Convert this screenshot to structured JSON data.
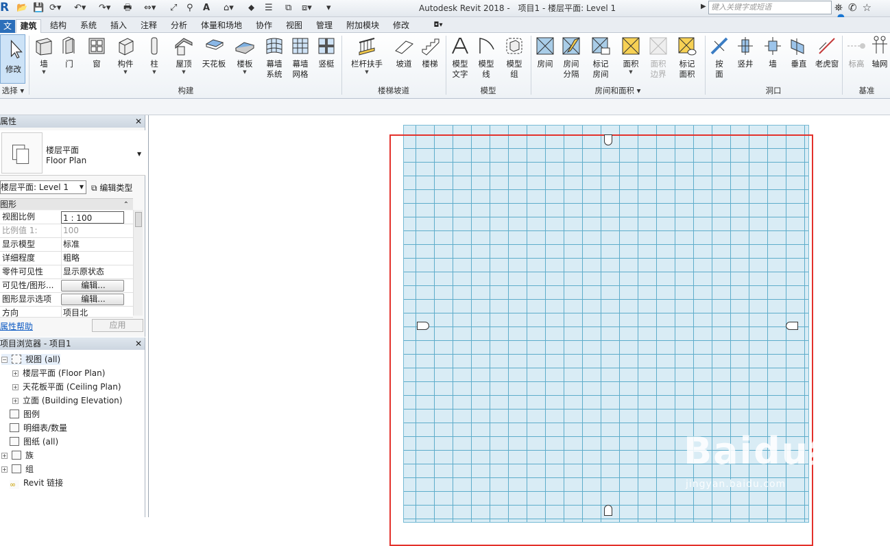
{
  "window": {
    "app_title": "Autodesk Revit 2018 -",
    "doc_title": "项目1 - 楼层平面: Level 1",
    "search_placeholder": "键入关键字或短语"
  },
  "tabs": [
    "文件",
    "建筑",
    "结构",
    "系统",
    "插入",
    "注释",
    "分析",
    "体量和场地",
    "协作",
    "视图",
    "管理",
    "附加模块",
    "修改"
  ],
  "active_tab": "建筑",
  "ribbon": {
    "modify": "修改",
    "select": "选择",
    "build": {
      "label": "构建",
      "buttons": [
        "墙",
        "门",
        "窗",
        "构件",
        "柱",
        "屋顶",
        "天花板",
        "楼板",
        "幕墙系统",
        "幕墙网格",
        "竖梃"
      ]
    },
    "circulation": {
      "label": "楼梯坡道",
      "buttons": [
        "栏杆扶手",
        "坡道",
        "楼梯"
      ]
    },
    "model": {
      "label": "模型",
      "buttons": [
        "模型文字",
        "模型线",
        "模型组"
      ]
    },
    "room_area": {
      "label": "房间和面积",
      "buttons": [
        "房间",
        "房间分隔",
        "标记房间",
        "面积",
        "面积边界",
        "标记面积"
      ]
    },
    "opening": {
      "label": "洞口",
      "buttons": [
        "按面",
        "竖井",
        "墙",
        "垂直",
        "老虎窗"
      ]
    },
    "datum": {
      "label": "基准",
      "buttons": [
        "标高",
        "轴网"
      ]
    }
  },
  "properties": {
    "title": "属性",
    "type_name_cn": "楼层平面",
    "type_name_en": "Floor Plan",
    "instance_selector": "楼层平面: Level 1",
    "edit_type": "编辑类型",
    "group": "图形",
    "rows": [
      {
        "key": "视图比例",
        "value": "1 : 100"
      },
      {
        "key": "比例值 1:",
        "value": "100"
      },
      {
        "key": "显示模型",
        "value": "标准"
      },
      {
        "key": "详细程度",
        "value": "粗略"
      },
      {
        "key": "零件可见性",
        "value": "显示原状态"
      },
      {
        "key": "可见性/图形...",
        "value": "编辑..."
      },
      {
        "key": "图形显示选项",
        "value": "编辑..."
      },
      {
        "key": "方向",
        "value": "项目北"
      }
    ],
    "help": "属性帮助",
    "apply": "应用"
  },
  "browser": {
    "title": "项目浏览器 - 项目1",
    "items": [
      "视图 (all)",
      "楼层平面 (Floor Plan)",
      "天花板平面 (Ceiling Plan)",
      "立面 (Building Elevation)",
      "图例",
      "明细表/数量",
      "图纸 (all)",
      "族",
      "组",
      "Revit 链接"
    ]
  },
  "watermark": {
    "logo": "Baidu经验",
    "url": "jingyan.baidu.com"
  },
  "colors": {
    "accent": "#2c6fba",
    "grid_fill": "#d7ecf5",
    "grid_line": "#55a8c8",
    "highlight": "#e3302a"
  }
}
